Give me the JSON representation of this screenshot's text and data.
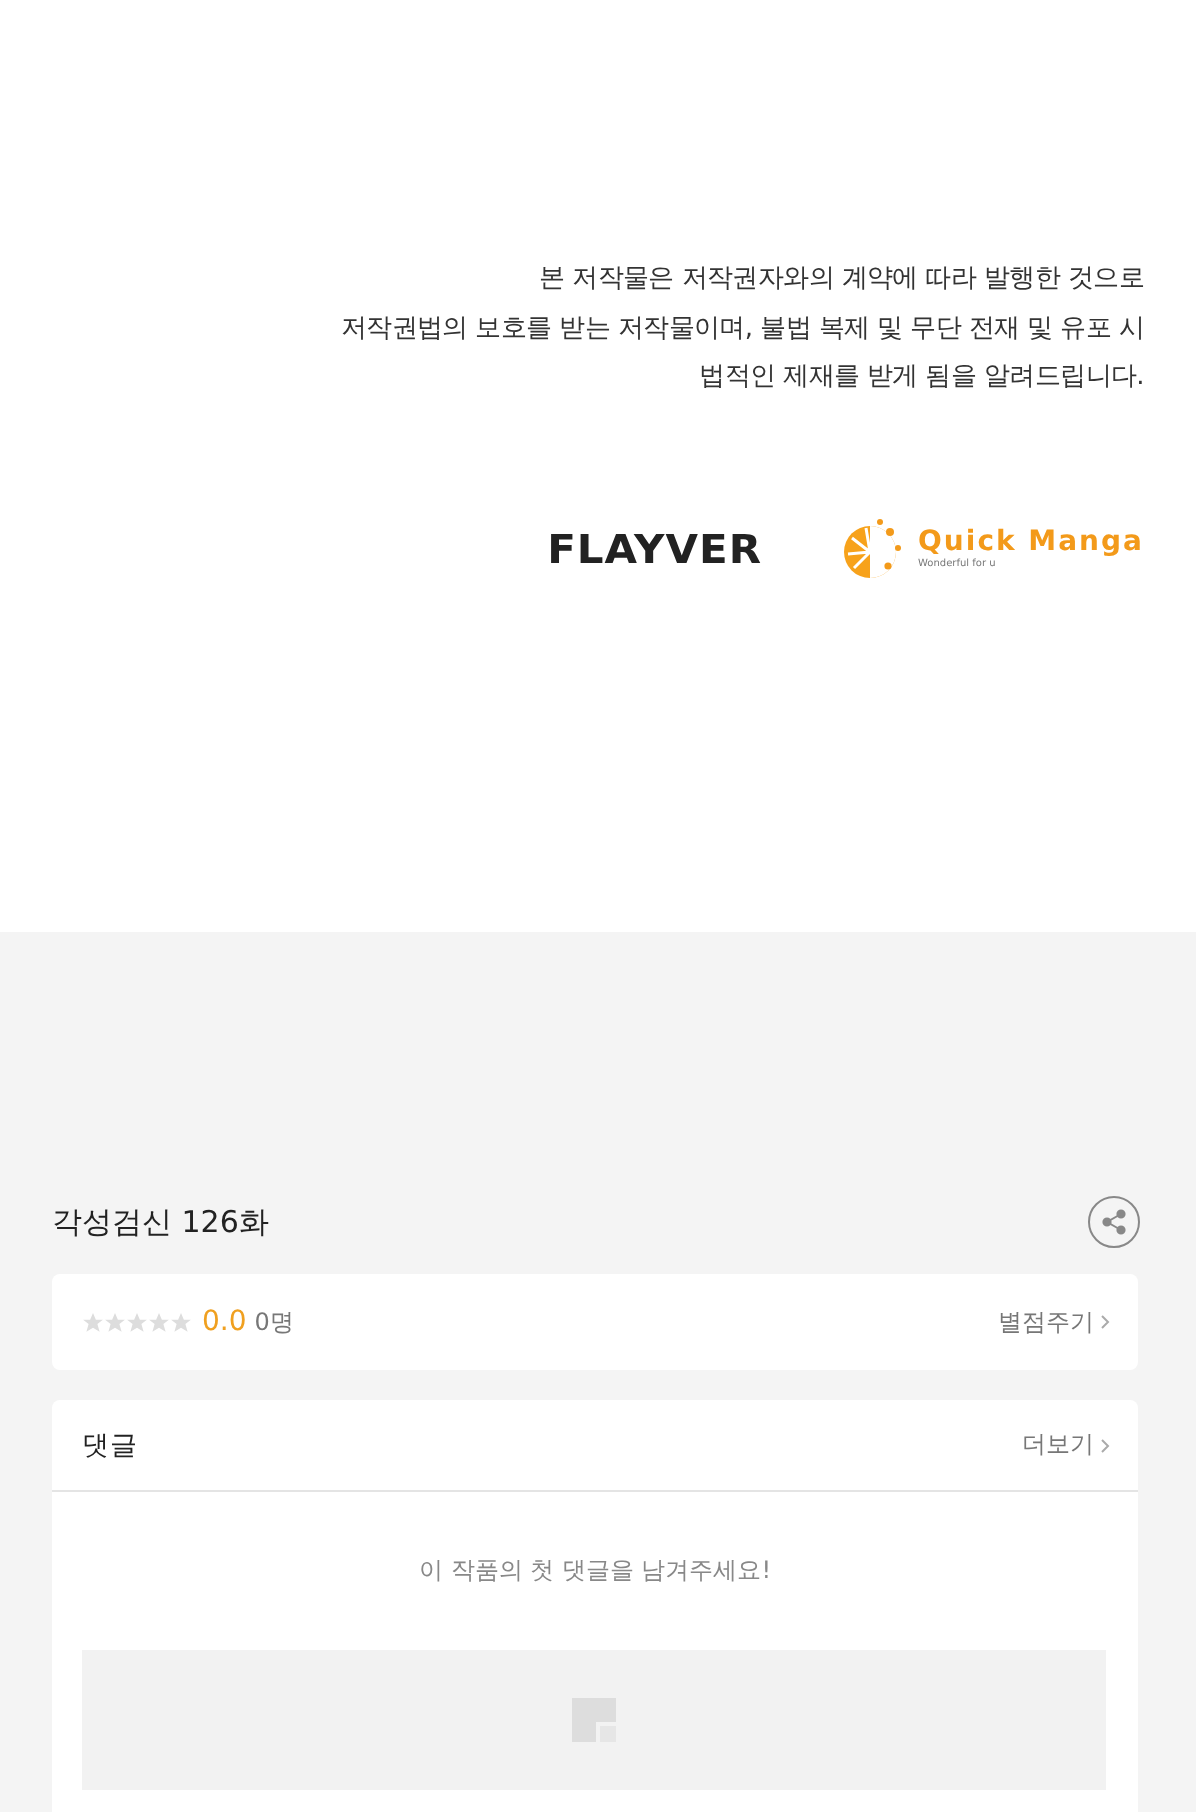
{
  "notice": {
    "lines": [
      "본 저작물은 저작권자와의 계약에 따라 발행한 것으로",
      "저작권법의 보호를 받는 저작물이며, 불법 복제 및 무단 전재 및 유포 시",
      "법적인 제재를 받게 됨을 알려드립니다."
    ]
  },
  "logos": [
    {
      "kind": "wordmark",
      "text": "FLAYVER"
    },
    {
      "kind": "orange",
      "text": "Quick Manga",
      "tagline": "Wonderful for u"
    }
  ],
  "episode": {
    "title": "각성검신 126화"
  },
  "rating": {
    "stars": 0,
    "score": "0.0",
    "count": "0명",
    "action": "별점주기"
  },
  "comments": {
    "title": "댓글",
    "more": "더보기",
    "empty_message": "이 작품의 첫 댓글을 남겨주세요!"
  }
}
